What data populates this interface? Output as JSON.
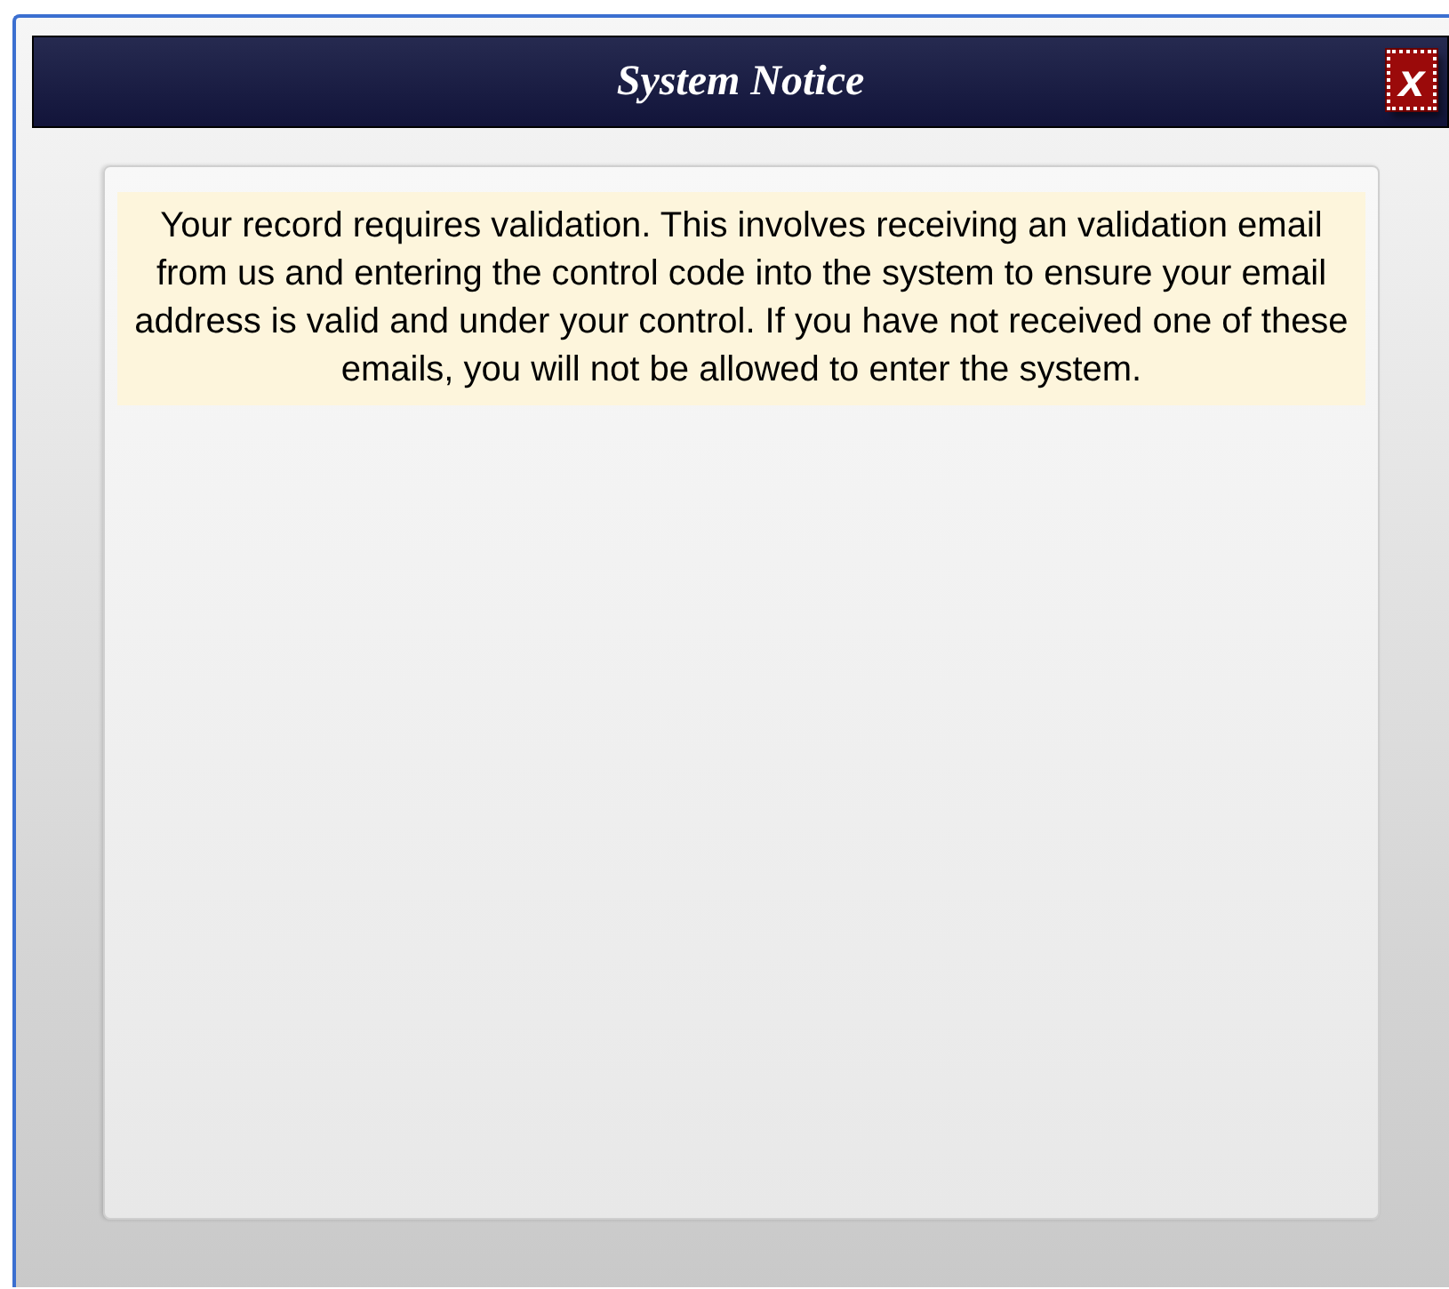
{
  "window": {
    "title": "System Notice",
    "close": "x"
  },
  "notice": {
    "message": "Your record requires validation. This involves receiving an validation email from us and entering the control code into the system to ensure your email address is valid and under your control. If you have not received one of these emails, you will not be allowed to enter the system."
  }
}
